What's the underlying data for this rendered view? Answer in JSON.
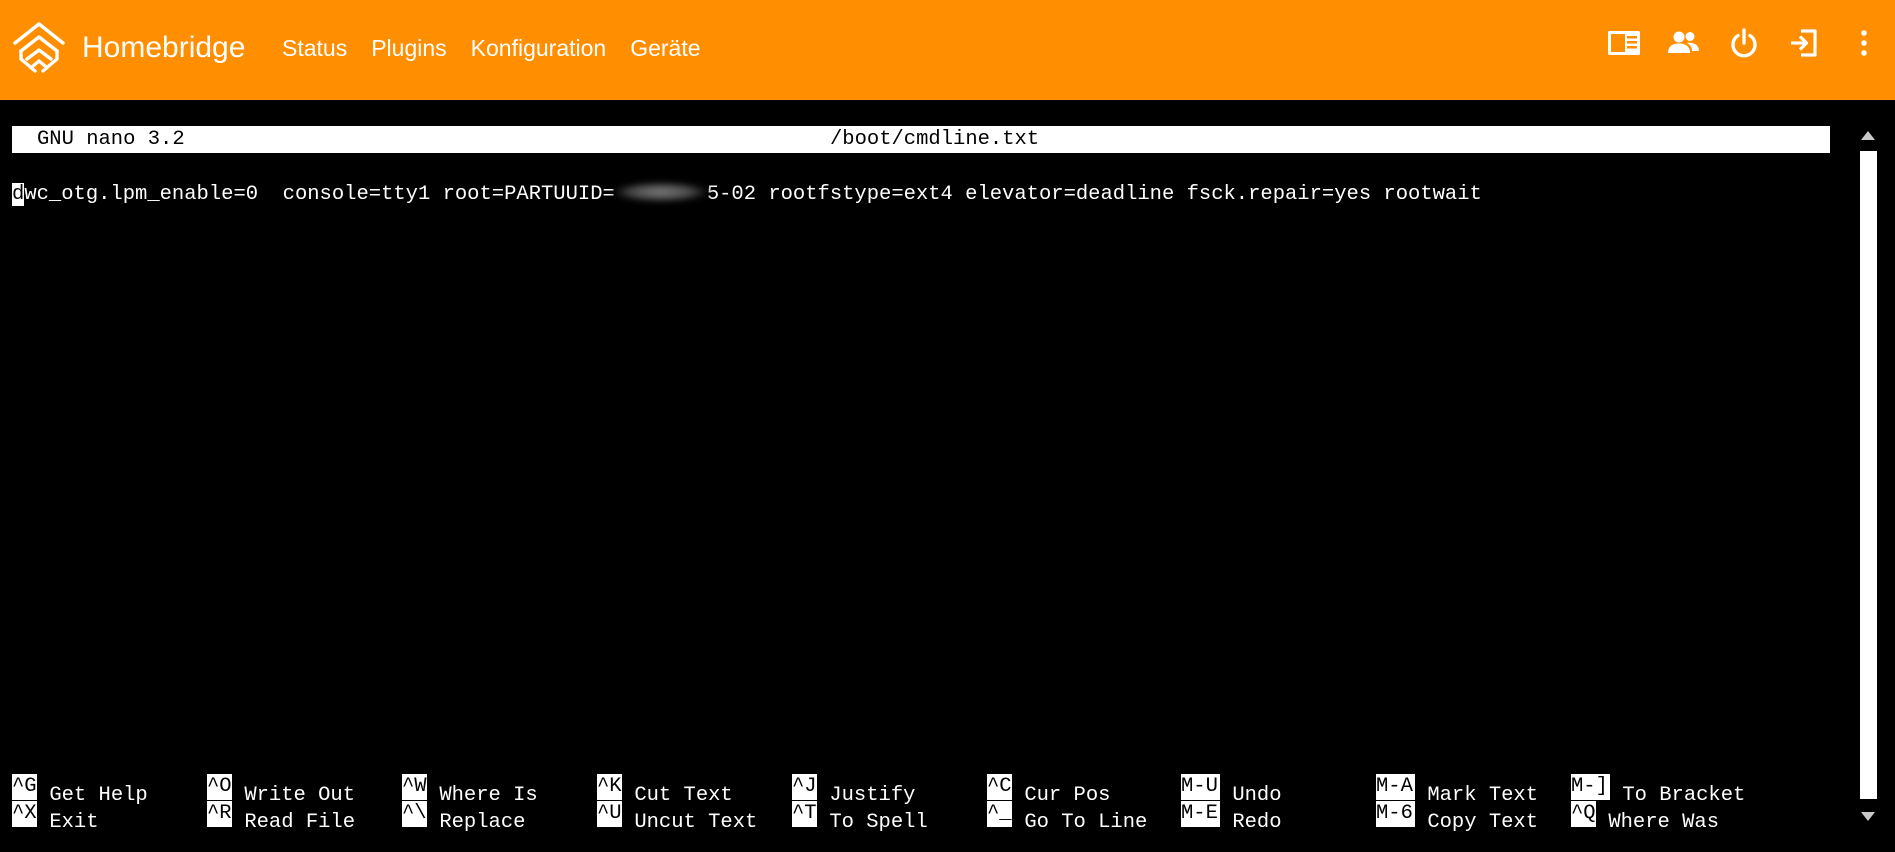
{
  "navbar": {
    "brand": "Homebridge",
    "brand_logo": "homebridge-logo",
    "links": [
      {
        "label": "Status"
      },
      {
        "label": "Plugins"
      },
      {
        "label": "Konfiguration"
      },
      {
        "label": "Geräte"
      }
    ],
    "actions": [
      {
        "icon": "layout-icon"
      },
      {
        "icon": "users-icon"
      },
      {
        "icon": "power-icon"
      },
      {
        "icon": "logout-icon"
      },
      {
        "icon": "more-vertical-icon"
      }
    ],
    "accent_color": "#ff8e00"
  },
  "nano": {
    "version": "GNU nano 3.2",
    "filename": "/boot/cmdline.txt",
    "cursor_char": "d",
    "line_before_blur": "wc_otg.lpm_enable=0  console=tty1 root=PARTUUID=",
    "line_after_blur": "5-02 rootfstype=ext4 elevator=deadline fsck.repair=yes rootwait"
  },
  "shortcuts": {
    "row1": [
      {
        "key": "^G",
        "label": "Get Help"
      },
      {
        "key": "^O",
        "label": "Write Out"
      },
      {
        "key": "^W",
        "label": "Where Is"
      },
      {
        "key": "^K",
        "label": "Cut Text"
      },
      {
        "key": "^J",
        "label": "Justify"
      },
      {
        "key": "^C",
        "label": "Cur Pos"
      },
      {
        "key": "M-U",
        "label": "Undo"
      },
      {
        "key": "M-A",
        "label": "Mark Text"
      },
      {
        "key": "M-]",
        "label": "To Bracket"
      }
    ],
    "row2": [
      {
        "key": "^X",
        "label": "Exit"
      },
      {
        "key": "^R",
        "label": "Read File"
      },
      {
        "key": "^\\",
        "label": "Replace"
      },
      {
        "key": "^U",
        "label": "Uncut Text"
      },
      {
        "key": "^T",
        "label": "To Spell"
      },
      {
        "key": "^_",
        "label": "Go To Line"
      },
      {
        "key": "M-E",
        "label": "Redo"
      },
      {
        "key": "M-6",
        "label": "Copy Text"
      },
      {
        "key": "^Q",
        "label": "Where Was"
      }
    ]
  }
}
